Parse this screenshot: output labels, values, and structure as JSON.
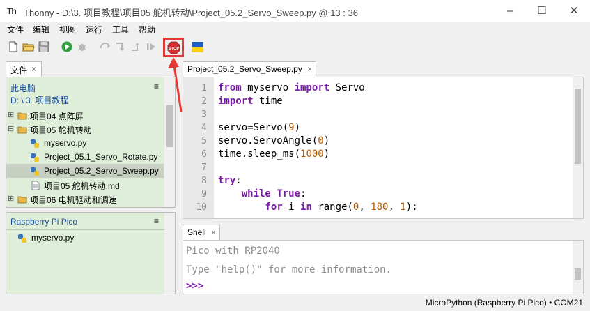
{
  "window": {
    "app_logo": "Th",
    "title": "Thonny  -  D:\\3. 项目教程\\项目05 舵机转动\\Project_05.2_Servo_Sweep.py  @  13 : 36",
    "minimize": "–",
    "maximize": "☐",
    "close": "✕"
  },
  "menu": [
    "文件",
    "编辑",
    "视图",
    "运行",
    "工具",
    "帮助"
  ],
  "toolbar": {
    "stop_label": "STOP",
    "icons": [
      "new-file-icon",
      "open-folder-icon",
      "save-icon",
      "run-icon",
      "debug-icon",
      "step-over-icon",
      "step-into-icon",
      "step-out-icon",
      "resume-icon",
      "stop-icon",
      "ukraine-flag-icon"
    ]
  },
  "files": {
    "tab_label": "文件",
    "tab_close": "×",
    "computer_label": "此电脑",
    "path_label": "D: \\ 3. 项目教程",
    "menu_glyph": "≡",
    "tree": [
      {
        "label": "项目04 点阵屏",
        "type": "folder",
        "toggle": "⊞"
      },
      {
        "label": "项目05 舵机转动",
        "type": "folder",
        "toggle": "⊟"
      },
      {
        "label": "myservo.py",
        "type": "python"
      },
      {
        "label": "Project_05.1_Servo_Rotate.py",
        "type": "python"
      },
      {
        "label": "Project_05.2_Servo_Sweep.py",
        "type": "python",
        "selected": true
      },
      {
        "label": "项目05 舵机转动.md",
        "type": "text"
      },
      {
        "label": "项目06 电机驱动和调速",
        "type": "folder",
        "toggle": "⊞"
      }
    ]
  },
  "device": {
    "title": "Raspberry Pi Pico",
    "menu_glyph": "≡",
    "files": [
      {
        "label": "myservo.py"
      }
    ]
  },
  "editor": {
    "tab_label": "Project_05.2_Servo_Sweep.py",
    "tab_close": "×",
    "line_numbers": [
      "1",
      "2",
      "3",
      "4",
      "5",
      "6",
      "7",
      "8",
      "9",
      "10"
    ]
  },
  "shell": {
    "tab_label": "Shell",
    "tab_close": "×",
    "lines": [
      "Pico with RP2040",
      "Type \"help()\" for more information."
    ],
    "prompt": ">>>"
  },
  "status": {
    "interpreter": "MicroPython (Raspberry Pi Pico)  •  COM21"
  },
  "colors": {
    "panel_bg": "#dfeed8",
    "keyword": "#7a1aa8",
    "number": "#b55a00",
    "highlight": "#e53935"
  }
}
